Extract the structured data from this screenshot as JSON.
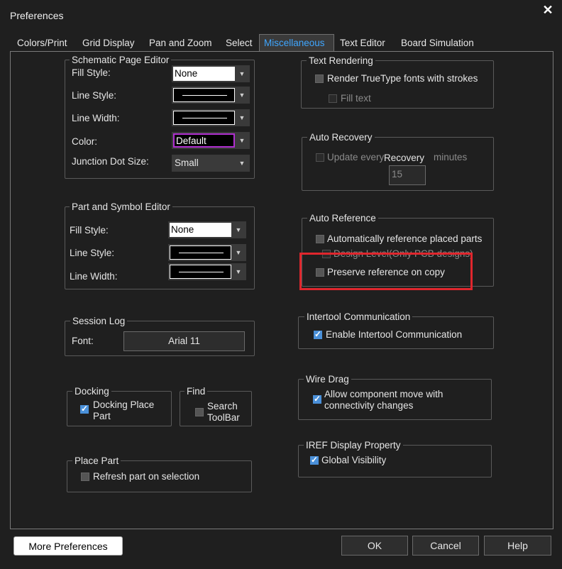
{
  "window": {
    "title": "Preferences",
    "close_glyph": "✕"
  },
  "tabs": [
    {
      "label": "Colors/Print",
      "active": false
    },
    {
      "label": "Grid Display",
      "active": false
    },
    {
      "label": "Pan and Zoom",
      "active": false
    },
    {
      "label": "Select",
      "active": false
    },
    {
      "label": "Miscellaneous",
      "active": true
    },
    {
      "label": "Text Editor",
      "active": false
    },
    {
      "label": "Board Simulation",
      "active": false
    }
  ],
  "schematic": {
    "legend": "Schematic Page Editor",
    "fill_style_label": "Fill Style:",
    "fill_style_value": "None",
    "line_style_label": "Line Style:",
    "line_width_label": "Line Width:",
    "color_label": "Color:",
    "color_value": "Default",
    "junction_label": "Junction Dot Size:",
    "junction_value": "Small"
  },
  "part_symbol": {
    "legend": "Part and Symbol Editor",
    "fill_style_label": "Fill Style:",
    "fill_style_value": "None",
    "line_style_label": "Line Style:",
    "line_width_label": "Line Width:"
  },
  "session_log": {
    "legend": "Session Log",
    "font_label": "Font:",
    "font_value": "Arial 11"
  },
  "docking": {
    "legend": "Docking",
    "checkbox_label_1": "Docking Place",
    "checkbox_label_2": "Part",
    "checked": true
  },
  "find": {
    "legend": "Find",
    "checkbox_label_1": "Search",
    "checkbox_label_2": "ToolBar",
    "checked": false
  },
  "place_part": {
    "legend": "Place Part",
    "checkbox_label": "Refresh part on selection",
    "checked": false
  },
  "text_rendering": {
    "legend": "Text Rendering",
    "render_label": "Render TrueType fonts with strokes",
    "render_checked": false,
    "fill_label": "Fill text",
    "fill_checked": false
  },
  "auto_recovery": {
    "legend": "Auto Recovery",
    "update_label": "Update every",
    "overlap_text": "Recovery",
    "minutes_label": "minutes",
    "interval_value": "15"
  },
  "auto_reference": {
    "legend": "Auto Reference",
    "auto_label": "Automatically reference placed parts",
    "auto_checked": false,
    "design_level_label": "Design Level(Only PCB designs)",
    "preserve_label": "Preserve reference on copy",
    "preserve_checked": false
  },
  "intertool": {
    "legend": "Intertool Communication",
    "enable_label": "Enable Intertool Communication",
    "checked": true
  },
  "wire_drag": {
    "legend": "Wire Drag",
    "label_1": "Allow component move with",
    "label_2": "connectivity changes",
    "checked": true
  },
  "iref": {
    "legend": "IREF Display Property",
    "label": "Global Visibility",
    "checked": true
  },
  "buttons": {
    "more": "More Preferences",
    "ok": "OK",
    "cancel": "Cancel",
    "help": "Help"
  },
  "colors": {
    "accent_tab": "#3fa6ff",
    "highlight": "#e0262d",
    "color_combo_border": "#b02fd0",
    "checkbox_checked": "#4a90d9"
  }
}
